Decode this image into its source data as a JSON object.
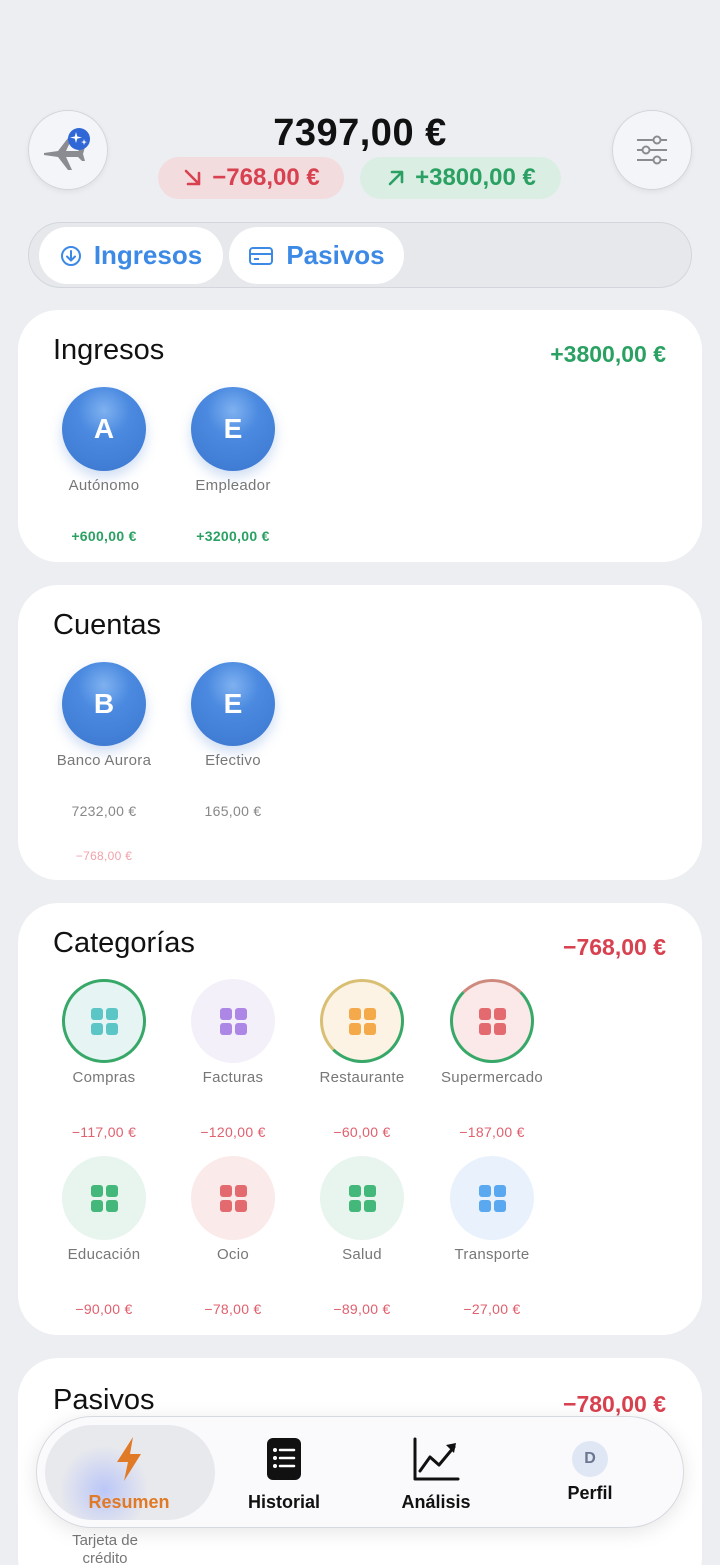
{
  "header": {
    "balance": "7397,00 €",
    "expense": "−768,00 €",
    "income": "+3800,00 €"
  },
  "tabs": [
    "Ingresos",
    "Pasivos"
  ],
  "ingresos": {
    "title": "Ingresos",
    "total": "+3800,00 €",
    "items": [
      {
        "initial": "A",
        "label": "Autónomo",
        "amount": "+600,00 €"
      },
      {
        "initial": "E",
        "label": "Empleador",
        "amount": "+3200,00 €"
      }
    ]
  },
  "cuentas": {
    "title": "Cuentas",
    "items": [
      {
        "initial": "B",
        "label": "Banco Aurora",
        "amount": "7232,00 €",
        "sub": "−768,00 €"
      },
      {
        "initial": "E",
        "label": "Efectivo",
        "amount": "165,00 €"
      }
    ]
  },
  "categorias": {
    "title": "Categorías",
    "total": "−768,00 €",
    "items": [
      {
        "label": "Compras",
        "amount": "−117,00 €",
        "color": "#5cc6c6"
      },
      {
        "label": "Facturas",
        "amount": "−120,00 €",
        "color": "#ad87e6"
      },
      {
        "label": "Restaurante",
        "amount": "−60,00 €",
        "color": "#f4a94a"
      },
      {
        "label": "Supermercado",
        "amount": "−187,00 €",
        "color": "#e36a6f"
      },
      {
        "label": "Educación",
        "amount": "−90,00 €",
        "color": "#44b87a"
      },
      {
        "label": "Ocio",
        "amount": "−78,00 €",
        "color": "#e36a6f"
      },
      {
        "label": "Salud",
        "amount": "−89,00 €",
        "color": "#44b87a"
      },
      {
        "label": "Transporte",
        "amount": "−27,00 €",
        "color": "#5aa8ef"
      }
    ]
  },
  "pasivos": {
    "title": "Pasivos",
    "total": "−780,00 €",
    "items": [
      {
        "label": "Tarjeta de crédito"
      }
    ]
  },
  "nav": {
    "items": [
      "Resumen",
      "Historial",
      "Análisis",
      "Perfil"
    ],
    "profile_initial": "D"
  }
}
